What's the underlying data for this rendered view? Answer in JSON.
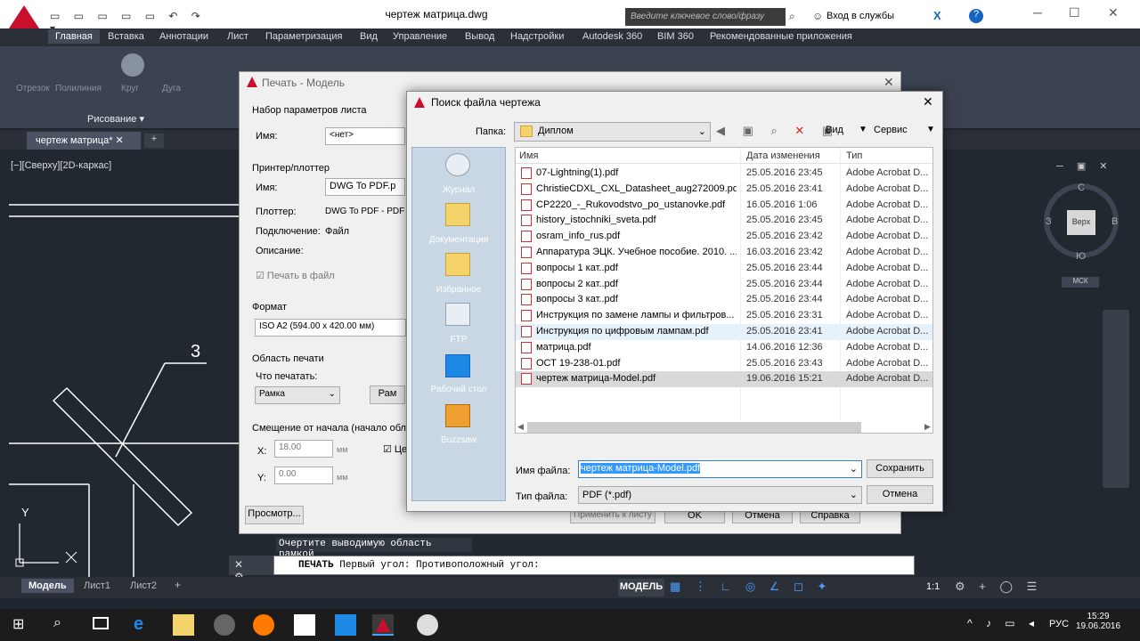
{
  "app": {
    "title": "чертеж матрица.dwg",
    "search_placeholder": "Введите ключевое слово/фразу",
    "login": "Вход в службы",
    "ribbon_tabs": [
      "Главная",
      "Вставка",
      "Аннотации",
      "Лист",
      "Параметризация",
      "Вид",
      "Управление",
      "Вывод",
      "Надстройки",
      "Autodesk 360",
      "BIM 360",
      "Рекомендованные приложения"
    ],
    "ribbon_panel": "Рисование",
    "ribbon_tools": [
      "Отрезок",
      "Полилиния",
      "Круг",
      "Дуга"
    ],
    "doc_tab": "чертеж матрица*",
    "view_label": "[−][Сверху][2D-каркас]",
    "viewcube": {
      "top": "С",
      "bottom": "Ю",
      "left": "З",
      "right": "В",
      "face": "Верх",
      "ucs": "МСК"
    },
    "drawing_callout": "3",
    "axis_y": "Y"
  },
  "print_dialog": {
    "title": "Печать - Модель",
    "page_setup_section": "Набор параметров листа",
    "name_label": "Имя:",
    "name_value": "<нет>",
    "printer_section": "Принтер/плоттер",
    "printer_name_label": "Имя:",
    "printer_name_value": "DWG To PDF.p",
    "plotter_label": "Плоттер:",
    "plotter_value": "DWG To PDF - PDF e",
    "connection_label": "Подключение:",
    "connection_value": "Файл",
    "description_label": "Описание:",
    "print_to_file": "Печать в файл",
    "format_section": "Формат",
    "format_value": "ISO A2 (594.00 x 420.00 мм)",
    "area_section": "Область печати",
    "what_label": "Что печатать:",
    "what_value": "Рамка",
    "what_button": "Рам",
    "offset_section": "Смещение от начала (начало област",
    "x_label": "X:",
    "x_value": "18.00",
    "y_label": "Y:",
    "y_value": "0.00",
    "unit": "мм",
    "center_label": "Це",
    "preview_button": "Просмотр...",
    "apply_button": "Применить к листу",
    "ok_button": "OK",
    "cancel_button": "Отмена",
    "help_button": "Справка"
  },
  "file_dialog": {
    "title": "Поиск файла чертежа",
    "folder_label": "Папка:",
    "folder_value": "Диплом",
    "view_menu": "Вид",
    "service_menu": "Сервис",
    "places": [
      "Журнал",
      "Документация",
      "Избранное",
      "FTP",
      "Рабочий стол",
      "Buzzsaw"
    ],
    "columns": {
      "name": "Имя",
      "date": "Дата изменения",
      "type": "Тип"
    },
    "files": [
      {
        "name": "07-Lightning(1).pdf",
        "date": "25.05.2016 23:45",
        "type": "Adobe Acrobat D..."
      },
      {
        "name": "ChristieCDXL_CXL_Datasheet_aug272009.pdf",
        "date": "25.05.2016 23:41",
        "type": "Adobe Acrobat D..."
      },
      {
        "name": "CP2220_-_Rukovodstvo_po_ustanovke.pdf",
        "date": "16.05.2016 1:06",
        "type": "Adobe Acrobat D..."
      },
      {
        "name": "history_istochniki_sveta.pdf",
        "date": "25.05.2016 23:45",
        "type": "Adobe Acrobat D..."
      },
      {
        "name": "osram_info_rus.pdf",
        "date": "25.05.2016 23:42",
        "type": "Adobe Acrobat D..."
      },
      {
        "name": "Аппаратура ЭЦК. Учебное пособие. 2010. ...",
        "date": "16.03.2016 23:42",
        "type": "Adobe Acrobat D..."
      },
      {
        "name": "вопросы 1 кат..pdf",
        "date": "25.05.2016 23:44",
        "type": "Adobe Acrobat D..."
      },
      {
        "name": "вопросы 2 кат..pdf",
        "date": "25.05.2016 23:44",
        "type": "Adobe Acrobat D..."
      },
      {
        "name": "вопросы 3 кат..pdf",
        "date": "25.05.2016 23:44",
        "type": "Adobe Acrobat D..."
      },
      {
        "name": "Инструкция по замене лампы и фильтров...",
        "date": "25.05.2016 23:31",
        "type": "Adobe Acrobat D..."
      },
      {
        "name": "Инструкция по цифровым лампам.pdf",
        "date": "25.05.2016 23:41",
        "type": "Adobe Acrobat D..."
      },
      {
        "name": "матрица.pdf",
        "date": "14.06.2016 12:36",
        "type": "Adobe Acrobat D..."
      },
      {
        "name": "ОСТ 19-238-01.pdf",
        "date": "25.05.2016 23:43",
        "type": "Adobe Acrobat D..."
      },
      {
        "name": "чертеж матрица-Model.pdf",
        "date": "19.06.2016 15:21",
        "type": "Adobe Acrobat D..."
      }
    ],
    "filename_label": "Имя файла:",
    "filename_value": "чертеж матрица-Model.pdf",
    "filetype_label": "Тип файла:",
    "filetype_value": "PDF (*.pdf)",
    "save_button": "Сохранить",
    "cancel_button": "Отмена"
  },
  "command": {
    "history": "Очертите выводимую область рамкой",
    "prompt_cmd": "ПЕЧАТЬ",
    "prompt_text": "Первый угол: Противоположный угол:"
  },
  "layout_tabs": [
    "Модель",
    "Лист1",
    "Лист2"
  ],
  "status": {
    "model": "МОДЕЛЬ",
    "scale": "1:1"
  },
  "taskbar": {
    "lang": "РУС",
    "time": "15:29",
    "date": "19.06.2016"
  }
}
